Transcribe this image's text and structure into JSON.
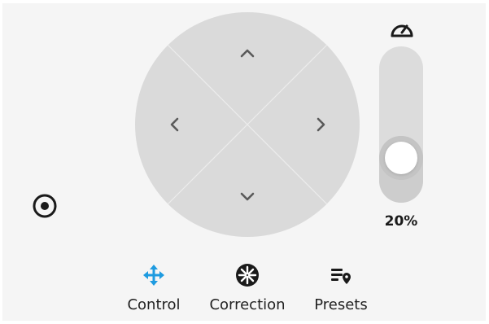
{
  "speed": {
    "icon": "speedometer-icon",
    "value_text": "20%",
    "level": 0.2
  },
  "center_control": {
    "icon": "target-icon"
  },
  "dpad": {
    "up_icon": "chevron-up-icon",
    "down_icon": "chevron-down-icon",
    "left_icon": "chevron-left-icon",
    "right_icon": "chevron-right-icon"
  },
  "tabs": [
    {
      "label": "Control",
      "icon": "move-arrows-icon",
      "active": true
    },
    {
      "label": "Correction",
      "icon": "aperture-icon",
      "active": false
    },
    {
      "label": "Presets",
      "icon": "list-pin-icon",
      "active": false
    }
  ],
  "colors": {
    "accent": "#1e9be0",
    "panel_bg": "#f5f5f5",
    "dpad_bg": "#dadada",
    "arrow": "#5a5a5a",
    "text": "#222222"
  }
}
